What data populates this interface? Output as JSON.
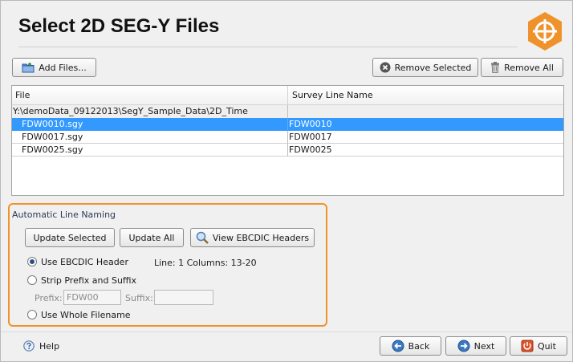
{
  "page": {
    "title": "Select 2D SEG-Y Files"
  },
  "toolbar": {
    "add_files": "Add Files...",
    "remove_selected": "Remove Selected",
    "remove_all": "Remove All"
  },
  "table": {
    "columns": [
      "File",
      "Survey Line Name"
    ],
    "directory": "Y:\\demoData_09122013\\SegY_Sample_Data\\2D_Time",
    "rows": [
      {
        "file": "FDW0010.sgy",
        "line": "FDW0010",
        "selected": true
      },
      {
        "file": "FDW0017.sgy",
        "line": "FDW0017",
        "selected": false
      },
      {
        "file": "FDW0025.sgy",
        "line": "FDW0025",
        "selected": false
      }
    ]
  },
  "naming": {
    "title": "Automatic Line Naming",
    "update_selected": "Update Selected",
    "update_all": "Update All",
    "view_ebcdic": "View EBCDIC Headers",
    "options": [
      {
        "label": "Use EBCDIC Header",
        "checked": true
      },
      {
        "label": "Strip Prefix and Suffix",
        "checked": false
      },
      {
        "label": "Use Whole Filename",
        "checked": false
      }
    ],
    "ebcdic_note": "Line: 1 Columns: 13-20",
    "prefix_label": "Prefix:",
    "prefix_value": "FDW00",
    "suffix_label": "Suffix:",
    "suffix_value": ""
  },
  "footer": {
    "help": "Help",
    "back": "Back",
    "next": "Next",
    "quit": "Quit"
  },
  "colors": {
    "accent_orange": "#f0922b",
    "selection_blue": "#3399ff"
  },
  "icons": {
    "add_files": "folder-plus-icon",
    "remove_selected": "remove-circle-icon",
    "remove_all": "trash-icon",
    "view_ebcdic": "magnifier-icon",
    "help": "help-icon",
    "back": "back-arrow-icon",
    "next": "next-arrow-icon",
    "quit": "quit-icon",
    "logo": "crosshair-hexagon-logo"
  }
}
